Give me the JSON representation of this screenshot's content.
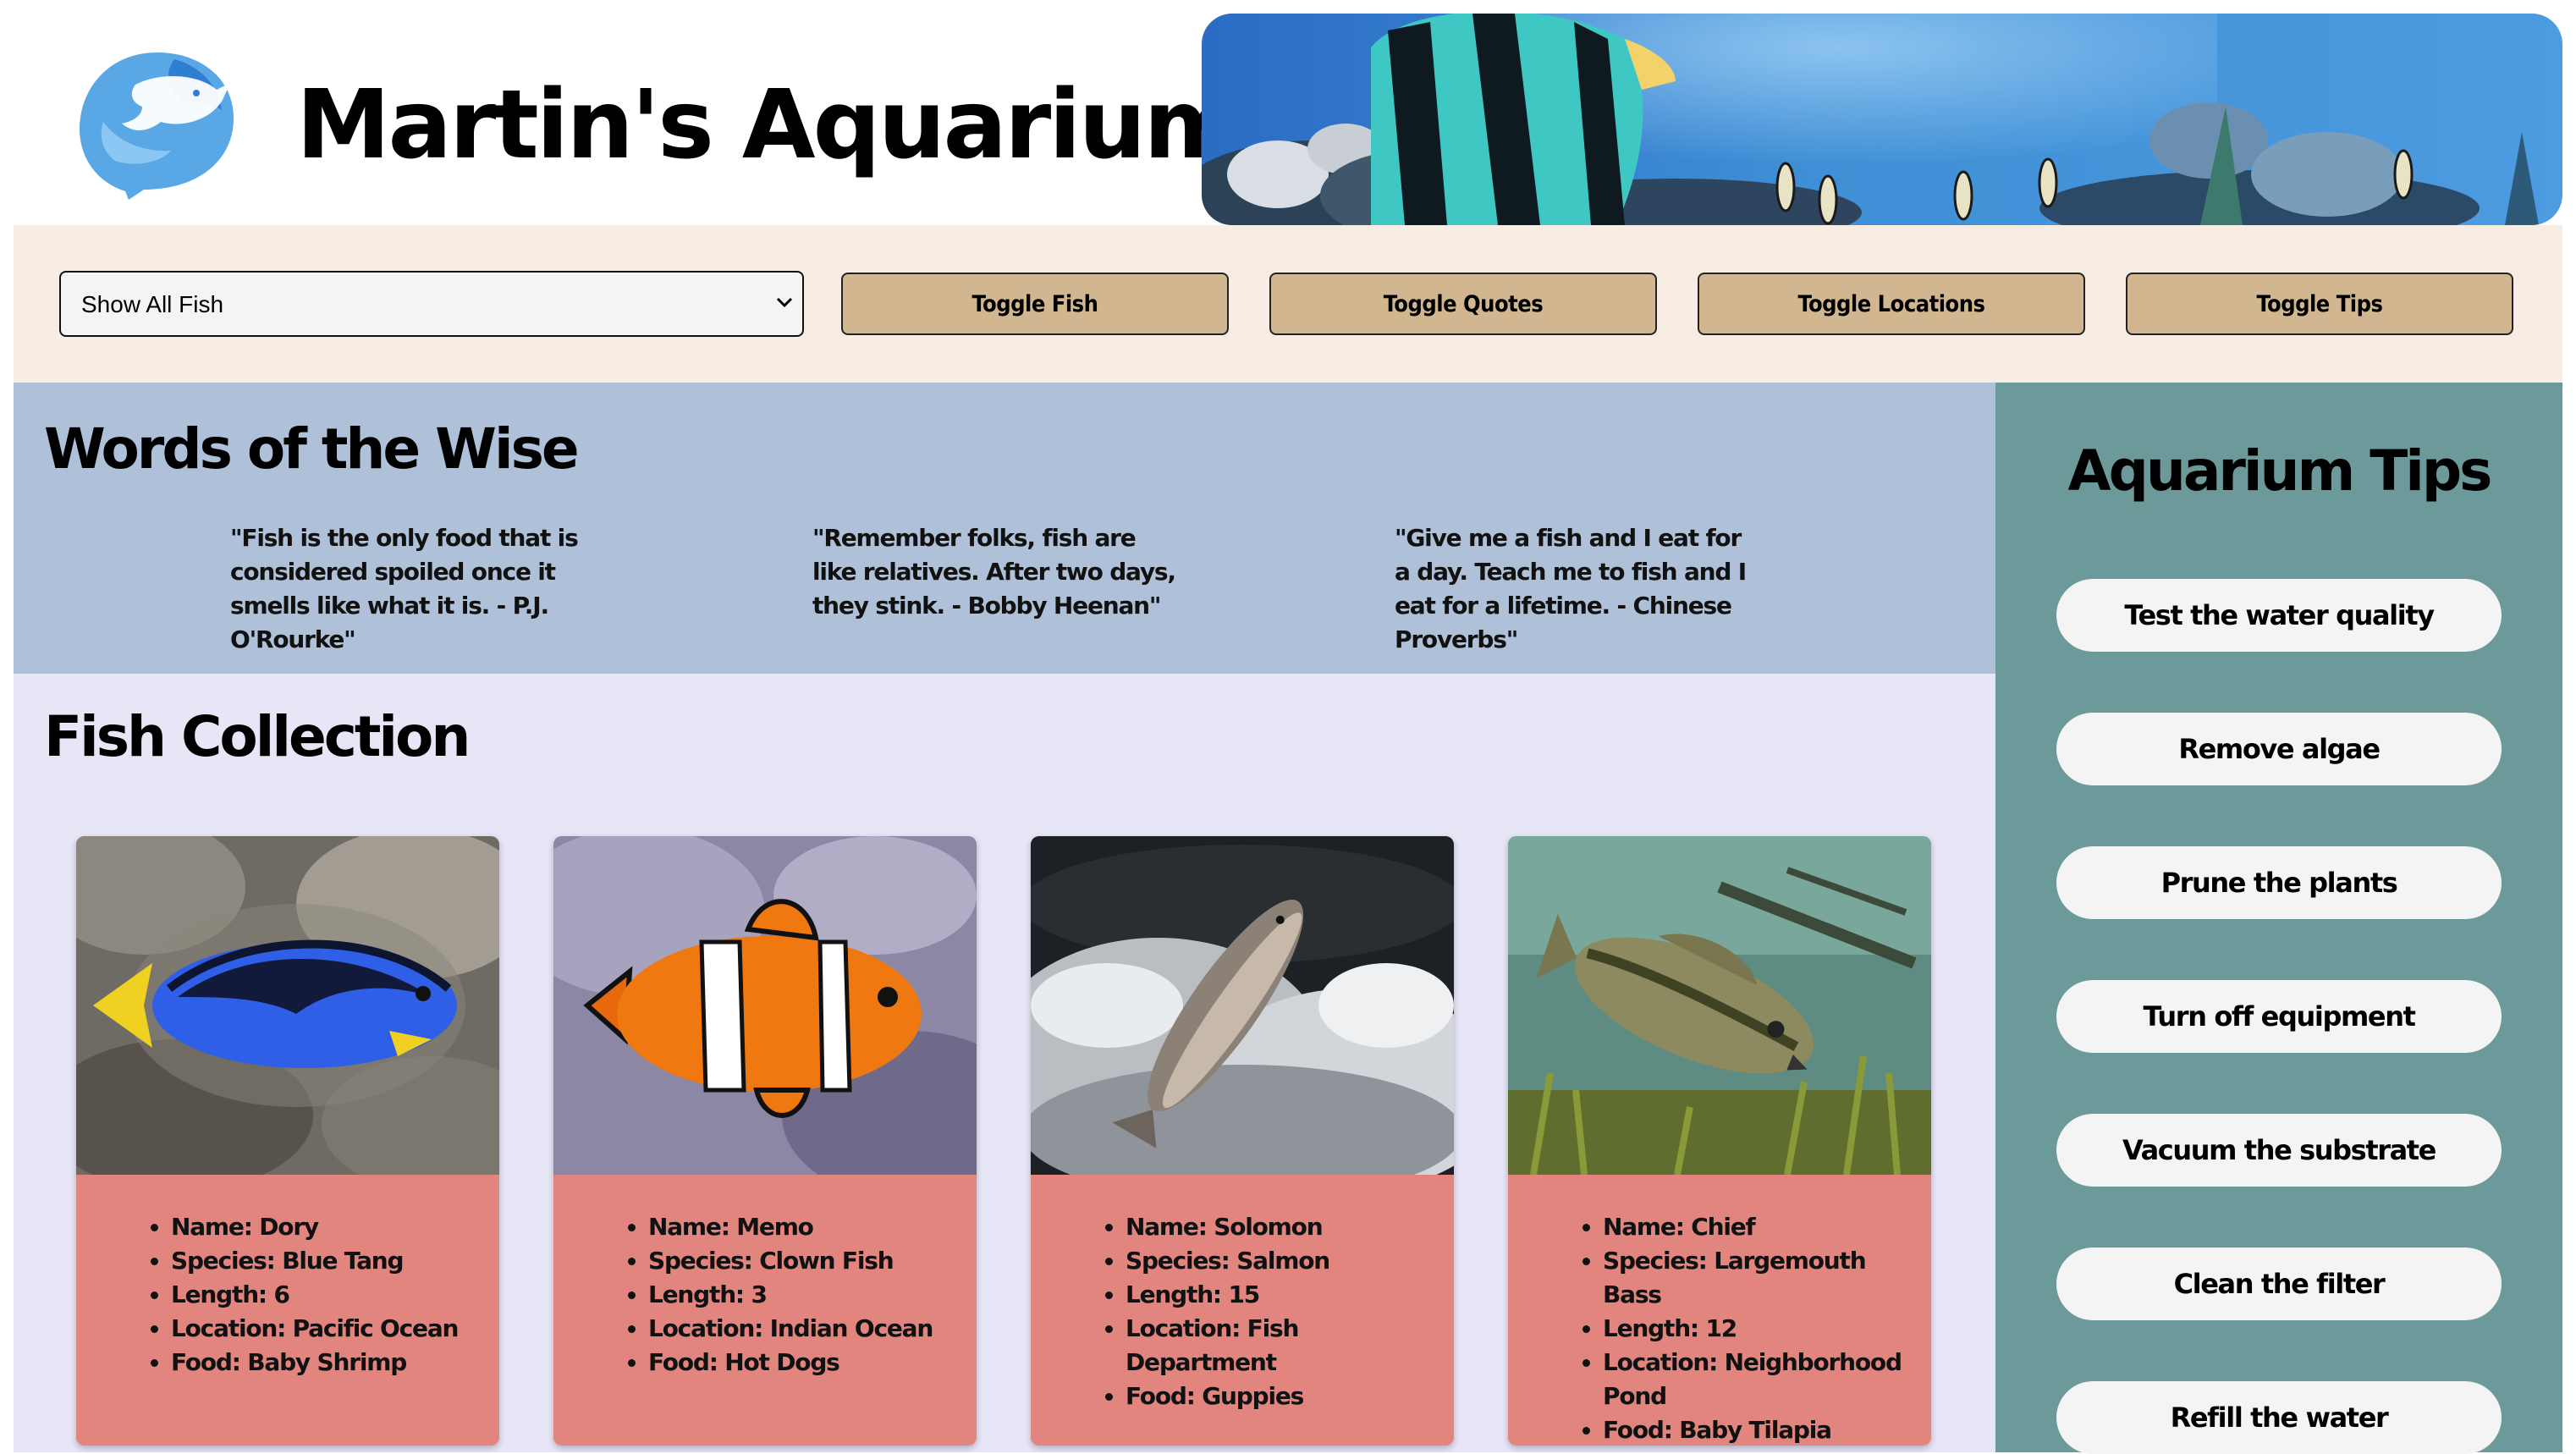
{
  "header": {
    "title": "Martin's Aquarium",
    "logo_icon": "dolphin-logo-icon",
    "banner": "tropical-fish-banner-image"
  },
  "controls": {
    "filter": {
      "selected": "Show All Fish",
      "options": [
        "Show All Fish"
      ]
    },
    "buttons": [
      "Toggle Fish",
      "Toggle Quotes",
      "Toggle Locations",
      "Toggle Tips"
    ],
    "button_color": "#d1b690"
  },
  "quotes": {
    "heading": "Words of the Wise",
    "items": [
      "\"Fish is the only food that is considered spoiled once it smells like what it is. - P.J. O'Rourke\"",
      "\"Remember folks, fish are like relatives. After two days, they stink. - Bobby Heenan\"",
      "\"Give me a fish and I eat for a day. Teach me to fish and I eat for a lifetime. - Chinese Proverbs\""
    ]
  },
  "collection": {
    "heading": "Fish Collection",
    "fish": [
      {
        "image": "blue-tang-photo",
        "details": [
          "Name: Dory",
          "Species: Blue Tang",
          "Length: 6",
          "Location: Pacific Ocean",
          "Food: Baby Shrimp"
        ]
      },
      {
        "image": "clown-fish-photo",
        "details": [
          "Name: Memo",
          "Species: Clown Fish",
          "Length: 3",
          "Location: Indian Ocean",
          "Food: Hot Dogs"
        ]
      },
      {
        "image": "salmon-photo",
        "details": [
          "Name: Solomon",
          "Species: Salmon",
          "Length: 15",
          "Location: Fish Department",
          "Food: Guppies"
        ]
      },
      {
        "image": "largemouth-bass-photo",
        "details": [
          "Name: Chief",
          "Species: Largemouth Bass",
          "Length: 12",
          "Location: Neighborhood Pond",
          "Food: Baby Tilapia"
        ]
      }
    ]
  },
  "tips": {
    "heading": "Aquarium Tips",
    "items": [
      "Test the water quality",
      "Remove algae",
      "Prune the plants",
      "Turn off equipment",
      "Vacuum the substrate",
      "Clean the filter",
      "Refill the water"
    ]
  },
  "colors": {
    "controls_bg": "#f7ede4",
    "quotes_bg": "#afc0d9",
    "collection_bg": "#e7e6f7",
    "tips_bg": "#6c9999",
    "card_info_bg": "#e2857f"
  }
}
